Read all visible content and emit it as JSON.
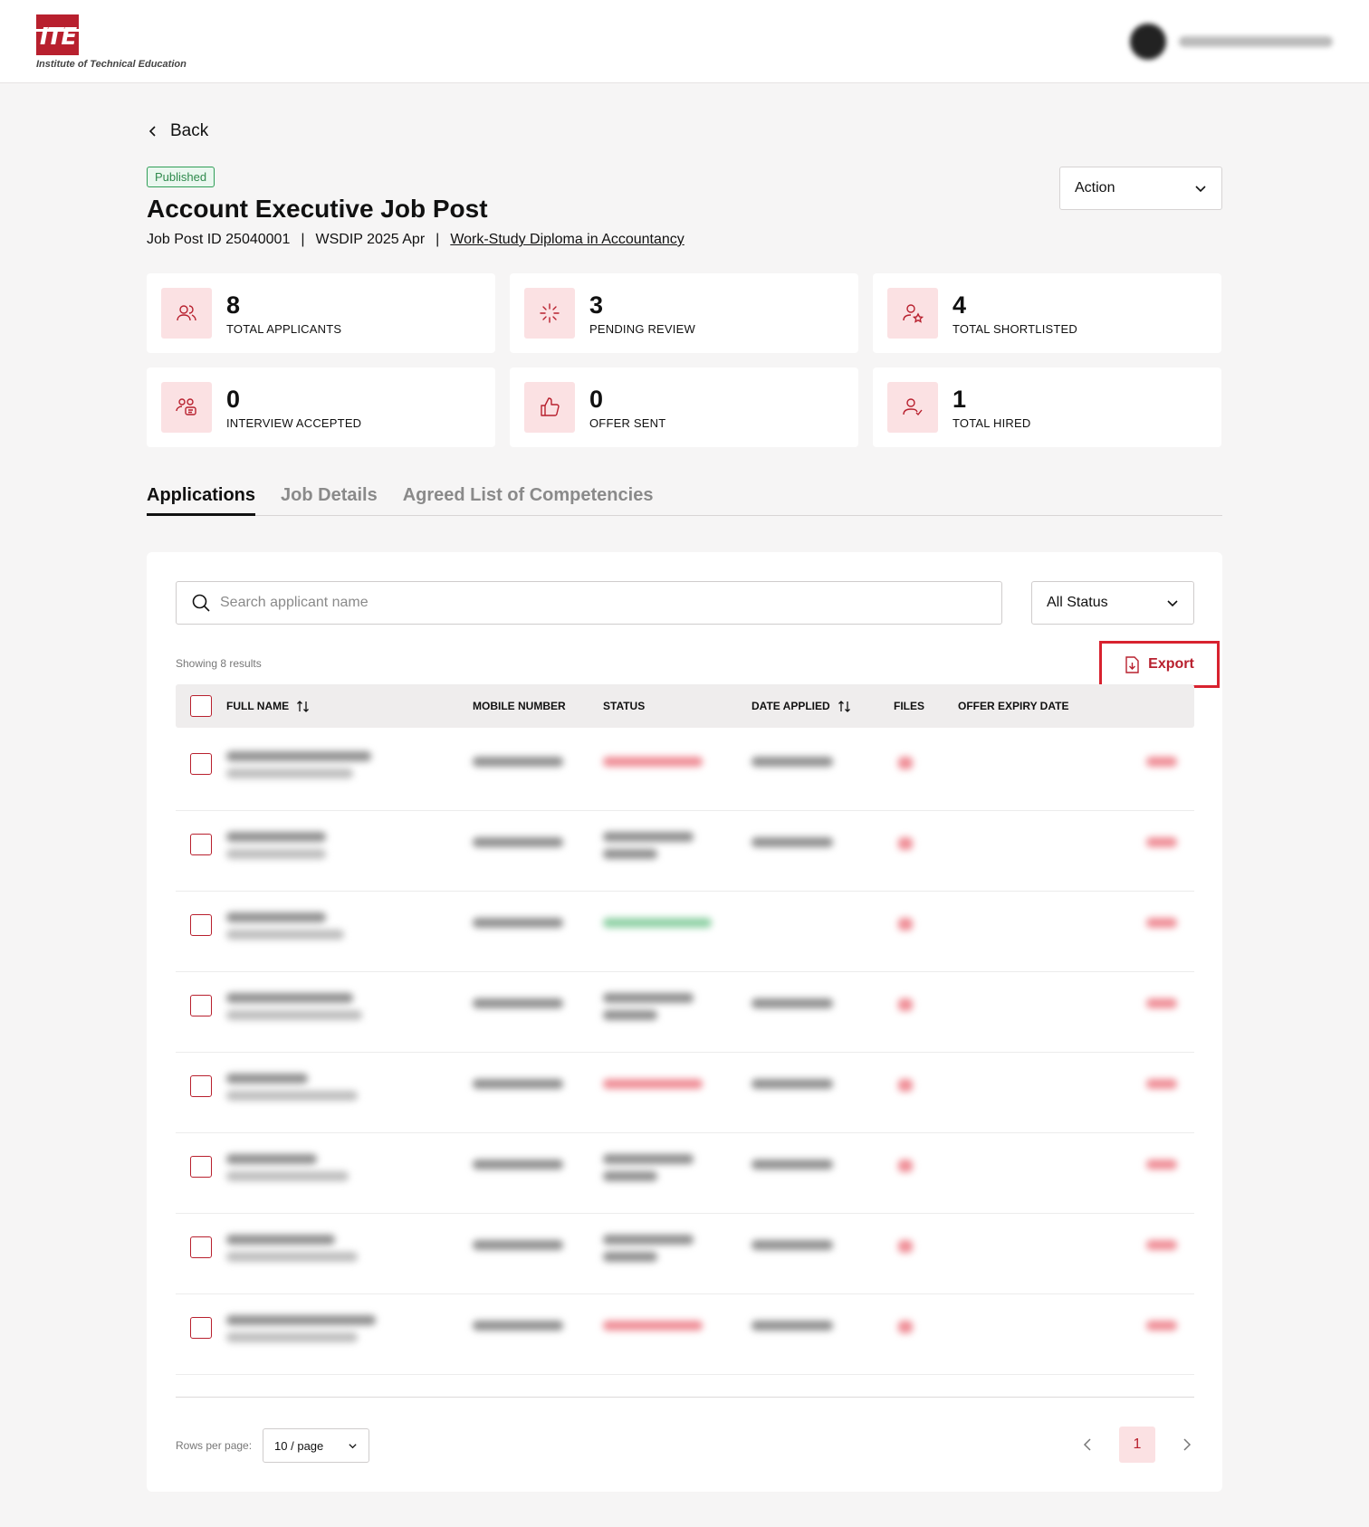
{
  "brand": {
    "logo_mark": "ITE",
    "logo_text": "Institute of Technical Education",
    "accent": "#b8202e"
  },
  "nav": {
    "back_label": "Back"
  },
  "job": {
    "status_badge": "Published",
    "title": "Account Executive Job Post",
    "id_text": "Job Post ID 25040001",
    "separator": "|",
    "intake": "WSDIP 2025 Apr",
    "course_link": "Work-Study Diploma in Accountancy"
  },
  "action_dropdown": {
    "label": "Action"
  },
  "stats": [
    {
      "value": "8",
      "label": "TOTAL APPLICANTS",
      "icon": "users-icon"
    },
    {
      "value": "3",
      "label": "PENDING REVIEW",
      "icon": "loader-icon"
    },
    {
      "value": "4",
      "label": "TOTAL SHORTLISTED",
      "icon": "user-star-icon"
    },
    {
      "value": "0",
      "label": "INTERVIEW ACCEPTED",
      "icon": "users-chat-icon"
    },
    {
      "value": "0",
      "label": "OFFER SENT",
      "icon": "thumbs-up-icon"
    },
    {
      "value": "1",
      "label": "TOTAL HIRED",
      "icon": "user-check-icon"
    }
  ],
  "tabs": [
    {
      "label": "Applications",
      "active": true
    },
    {
      "label": "Job Details",
      "active": false
    },
    {
      "label": "Agreed List of Competencies",
      "active": false
    }
  ],
  "search": {
    "placeholder": "Search applicant name"
  },
  "status_filter": {
    "selected": "All Status"
  },
  "results_text": "Showing 8 results",
  "export_label": "Export",
  "table": {
    "columns": {
      "full_name": "FULL NAME",
      "mobile": "MOBILE NUMBER",
      "status": "STATUS",
      "date_applied": "DATE APPLIED",
      "files": "FILES",
      "offer_expiry": "OFFER EXPIRY DATE"
    }
  },
  "pagination": {
    "rows_label": "Rows per page:",
    "rows_value": "10 / page",
    "current_page": "1"
  }
}
